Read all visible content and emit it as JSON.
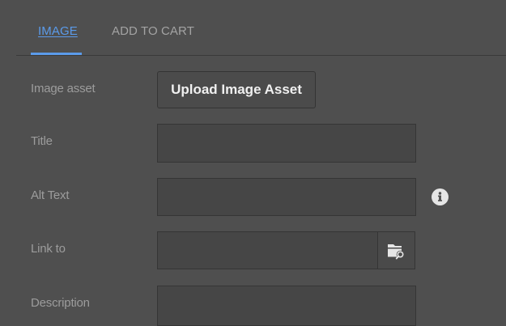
{
  "tabs": [
    {
      "label": "IMAGE",
      "active": true
    },
    {
      "label": "ADD TO CART",
      "active": false
    }
  ],
  "form": {
    "image_asset": {
      "label": "Image asset",
      "button_label": "Upload Image Asset"
    },
    "title": {
      "label": "Title",
      "value": ""
    },
    "alt_text": {
      "label": "Alt Text",
      "value": "",
      "info_icon": "info-icon"
    },
    "link_to": {
      "label": "Link to",
      "value": "",
      "browse_icon": "folder-search-icon"
    },
    "description": {
      "label": "Description",
      "value": ""
    }
  },
  "colors": {
    "background": "#4f4f4f",
    "accent": "#5b9bea",
    "field_background": "#464646",
    "label_text": "#9c9c9c"
  }
}
